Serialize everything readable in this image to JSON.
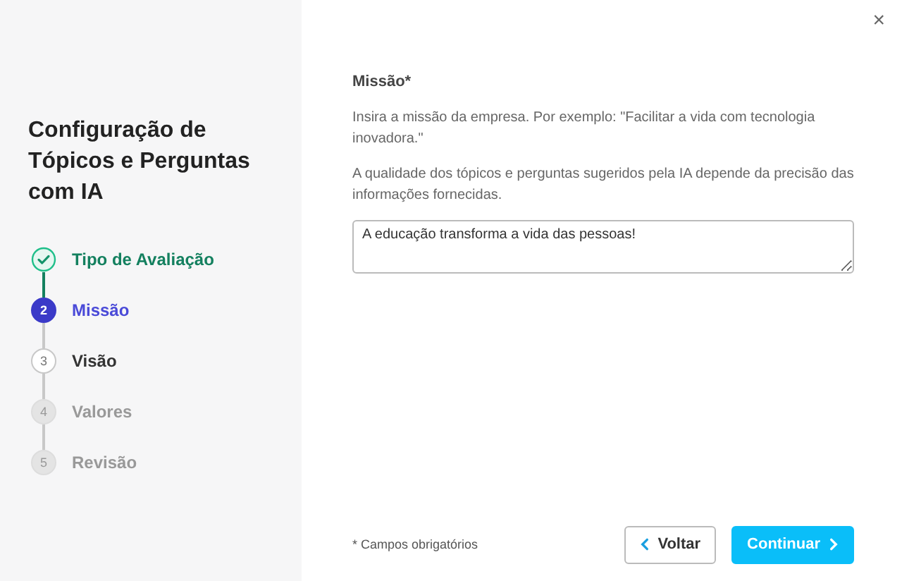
{
  "sidebar": {
    "title": "Configuração de Tópicos e Perguntas com IA",
    "steps": [
      {
        "label": "Tipo de Avaliação",
        "kind": "done",
        "selected": false
      },
      {
        "number": "2",
        "label": "Missão",
        "kind": "open",
        "selected": true
      },
      {
        "number": "3",
        "label": "Visão",
        "kind": "open",
        "selected": false
      },
      {
        "number": "4",
        "label": "Valores",
        "kind": "locked",
        "selected": false
      },
      {
        "number": "5",
        "label": "Revisão",
        "kind": "locked",
        "selected": false
      }
    ]
  },
  "close": "×",
  "form": {
    "label": "Missão*",
    "hint": "Insira a missão da empresa. Por exemplo: \"Facilitar a vida com tecnologia inovadora.\"",
    "note": "A qualidade dos tópicos e perguntas sugeridos pela IA depende da precisão das informações fornecidas.",
    "value": "A educação transforma a vida das pessoas!"
  },
  "footer": {
    "required_note": "* Campos obrigatórios",
    "back": "Voltar",
    "next": "Continuar"
  }
}
